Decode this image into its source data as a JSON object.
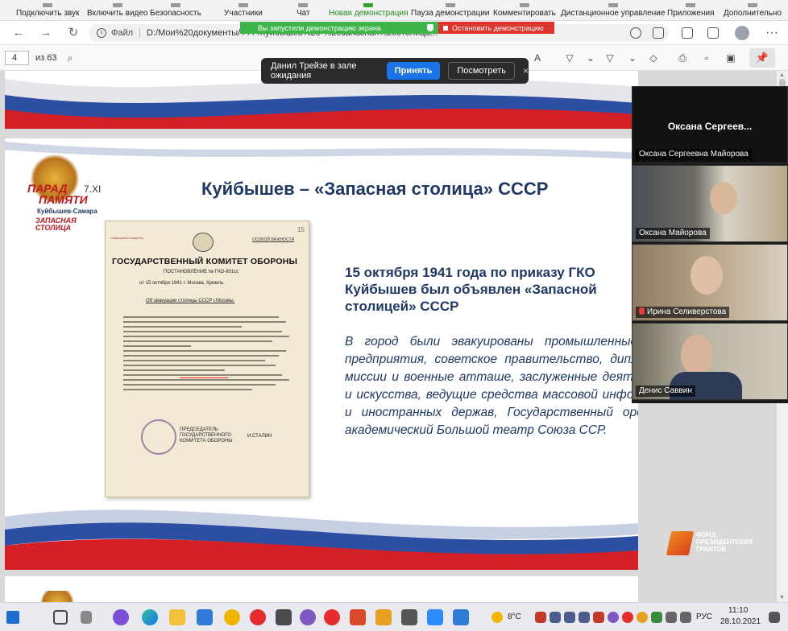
{
  "zoom_toolbar": {
    "items": [
      "Подключить звук",
      "Включить видео",
      "Безопасность",
      "Участники",
      "Чат",
      "Новая демонстрация",
      "Пауза демонстрации",
      "Комментировать",
      "Дистанционное управление",
      "Приложения",
      "Дополнительно"
    ],
    "sharing_banner": "Вы запустили демонстрацию экрана",
    "stop_button": "Остановить демонстрацию"
  },
  "browser": {
    "file_label": "Файл",
    "url": "D:/Мои%20документы/               /               /               /               /Куйбышев%20-%20запасная%20столица..."
  },
  "pdf_toolbar": {
    "page_current": "4",
    "page_total": "из 63"
  },
  "waiting_room": {
    "message": "Данил Трейзе в зале ожидания",
    "accept": "Принять",
    "view": "Посмотреть",
    "close": "×"
  },
  "slide": {
    "title": "Куйбышев – «Запасная столица» СССР",
    "logo": {
      "line1": "ПАРАД",
      "line2": "ПАМЯТИ",
      "number": "7.XI",
      "city": "Куйбышев-Самара",
      "tagline": "ЗАПАСНАЯ СТОЛИЦА"
    },
    "heading": "15 октября 1941 года по приказу ГКО Куйбышев был объявлен «Запасной столицей» СССР",
    "body": "В город были эвакуированы промышленные, оборонные предприятия, советское правительство, дипломатические миссии и военные атташе, заслуженные деятели культуры и искусства, ведущие средства массовой информации СССР и иностранных держав, Государственный ордена Ленина академический Большой театр Союза ССР.",
    "document": {
      "header": "ГОСУДАРСТВЕННЫЙ КОМИТЕТ ОБОРОНЫ",
      "subheader": "ПОСТАНОВЛЕНИЕ № ГКО-801сс",
      "date": "от 15 октября 1941 г. Москва, Кремль.",
      "topic": "Об эвакуации столицы СССР г.Москвы.",
      "corner": "Совершенно секретно",
      "classification": "ОСОБОЙ ВАЖНОСТИ",
      "page_number": "15",
      "signature_title": "ПРЕДСЕДАТЕЛЬ ГОСУДАРСТВЕННОГО КОМИТЕТА ОБОРОНЫ",
      "signature_name": "И.СТАЛИН"
    },
    "fund_logo": "ФОНД ПРЕЗИДЕНТСКИХ ГРАНТОВ"
  },
  "participants": [
    {
      "big_name": "Оксана Сергеев...",
      "label": "Оксана Сергеевна Майорова",
      "muted": false
    },
    {
      "big_name": "",
      "label": "Оксана Майорова",
      "muted": false
    },
    {
      "big_name": "",
      "label": "Ирина Селиверстова",
      "muted": true
    },
    {
      "big_name": "",
      "label": "Денис Саввин",
      "muted": false
    }
  ],
  "taskbar": {
    "weather": "8°C",
    "language": "РУС",
    "time": "11:10",
    "date": "28.10.2021"
  },
  "colors": {
    "slide_blue": "#1f3864",
    "zoom_green": "#3cb648",
    "zoom_red": "#e0332b",
    "accept_blue": "#1a73e8"
  }
}
